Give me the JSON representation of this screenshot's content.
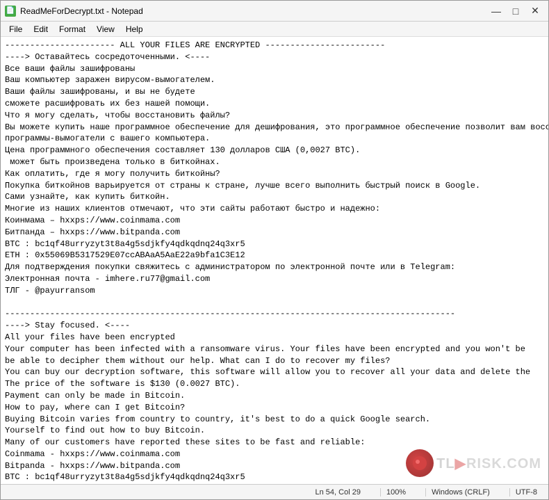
{
  "window": {
    "title": "ReadMeForDecrypt.txt - Notepad",
    "icon": "📄"
  },
  "menu": {
    "items": [
      "File",
      "Edit",
      "Format",
      "View",
      "Help"
    ]
  },
  "content": "---------------------- ALL YOUR FILES ARE ENCRYPTED ------------------------\n----> Оставайтесь сосредоточенными. <----\nВсе ваши файлы зашифрованы\nВаш компьютер заражен вирусом-вымогателем.\nВаши файлы зашифрованы, и вы не будете\nсможете расшифровать их без нашей помощи.\nЧто я могу сделать, чтобы восстановить файлы?\nВы можете купить наше программное обеспечение для дешифрования, это программное обеспечение позволит вам восстановить все ваши данные и удалить\nпрограммы-вымогатели с вашего компьютера.\nЦена программного обеспечения составляет 130 долларов США (0,0027 BTC).\n может быть произведена только в биткойнах.\nКак оплатить, где я могу получить биткойны?\nПокупка биткойнов варьируется от страны к стране, лучше всего выполнить быстрый поиск в Google.\nСами узнайте, как купить биткойн.\nМногие из наших клиентов отмечают, что эти сайты работают быстро и надежно:\nКоинмама – hxxps://www.coinmama.com\nБитпанда – hxxps://www.bitpanda.com\nBTC : bc1qf48urryzyt3t8a4g5sdjkfy4qdkqdnq24q3xr5\nETH : 0x55069B5317529E07ccABAaA5AaE22a9bfa1C3E12\nДля подтверждения покупки свяжитесь с администратором по электронной почте или в Telegram:\nЭлектронная почта - imhere.ru77@gmail.com\nТЛГ - @payurransom\n\n------------------------------------------------------------------------------------------\n----> Stay focused. <----\nAll your files have been encrypted\nYour computer has been infected with a ransomware virus. Your files have been encrypted and you won't be\nbe able to decipher them without our help. What can I do to recover my files?\nYou can buy our decryption software, this software will allow you to recover all your data and delete the\nThe price of the software is $130 (0.0027 BTC).\nPayment can only be made in Bitcoin.\nHow to pay, where can I get Bitcoin?\nBuying Bitcoin varies from country to country, it's best to do a quick Google search.\nYourself to find out how to buy Bitcoin.\nMany of our customers have reported these sites to be fast and reliable:\nCoinmama - hxxps://www.coinmama.com\nBitpanda - hxxps://www.bitpanda.com\nBTC : bc1qf48urryzyt3t8a4g5sdjkfy4qdkqdnq24q3xr5\nETH : 0x55069B5317529E07ccABAaA5AaE22a9bfa1C3E12\nTo confirm your purchase, please contact the administrator via email or Telegram:\nEmail - imhere.ru77@gmail.com\nTLG - @payurransom",
  "status_bar": {
    "line_col": "Ln 54, Col 29",
    "zoom": "100%",
    "line_ending": "Windows (CRLF)",
    "encoding": "UTF-8"
  },
  "watermark": {
    "text": "RISK.COM",
    "prefix": "TL"
  },
  "title_buttons": {
    "minimize": "—",
    "maximize": "□",
    "close": "✕"
  }
}
